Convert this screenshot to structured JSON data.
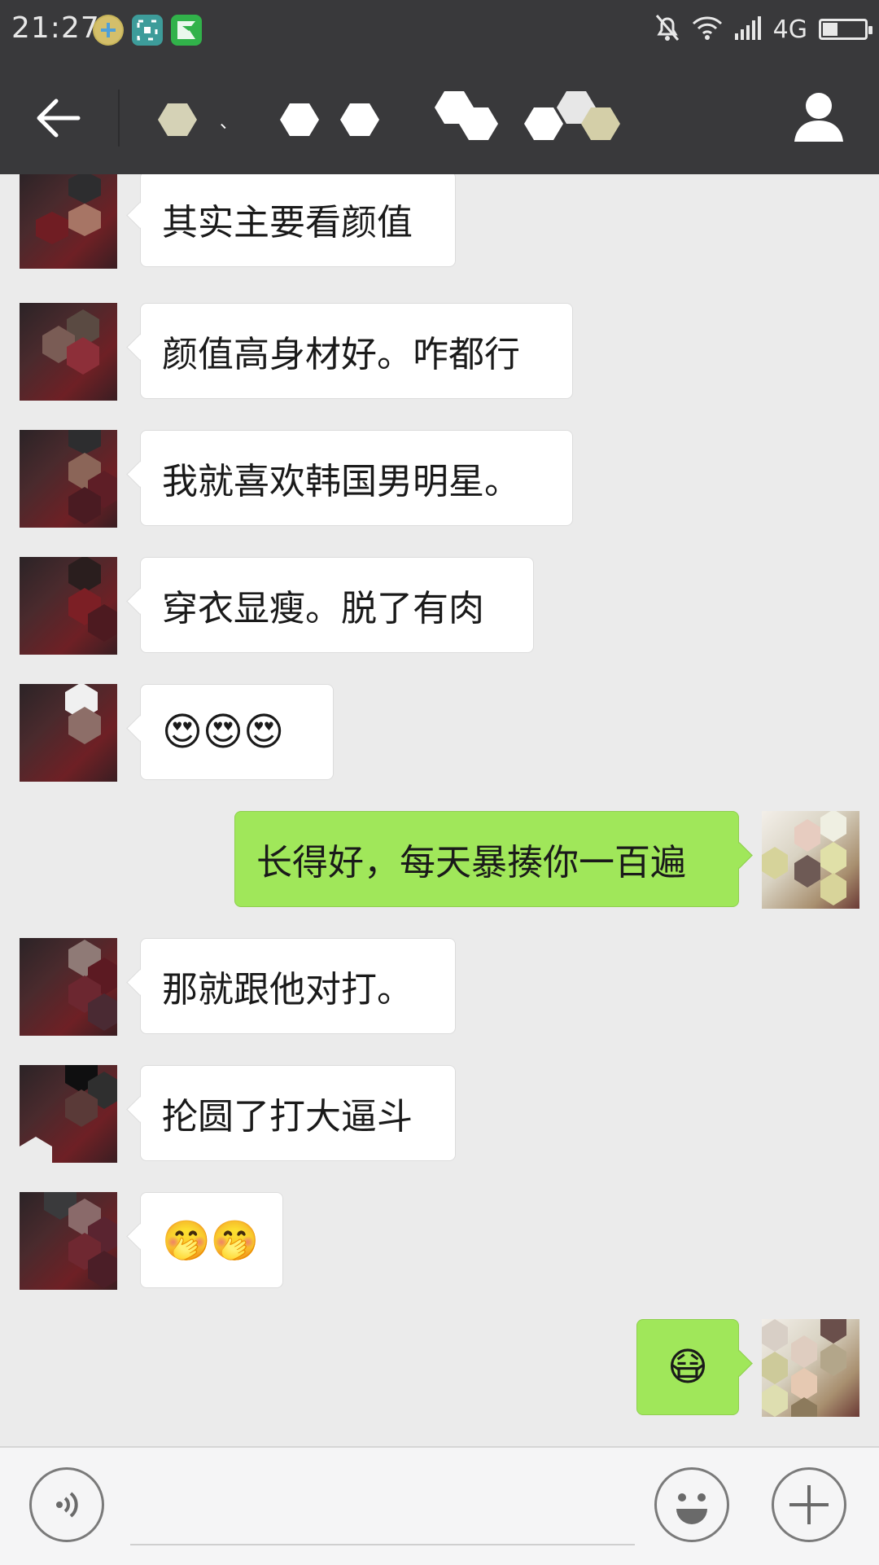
{
  "status_bar": {
    "time": "21:27",
    "network": "4G",
    "battery_level": 0.35,
    "icons": [
      "app-green-plus-icon",
      "app-scan-icon",
      "app-green-flag-icon",
      "mute-bell-icon",
      "wifi-icon",
      "signal-icon",
      "battery-icon"
    ]
  },
  "header": {
    "title_visible": "、",
    "back_icon": "arrow-left-icon",
    "profile_icon": "person-icon"
  },
  "messages": [
    {
      "side": "left",
      "type": "text",
      "text": "其实主要看颜值"
    },
    {
      "side": "left",
      "type": "text",
      "text": "颜值高身材好。咋都行"
    },
    {
      "side": "left",
      "type": "text",
      "text": "我就喜欢韩国男明星。"
    },
    {
      "side": "left",
      "type": "text",
      "text": "穿衣显瘦。脱了有肉"
    },
    {
      "side": "left",
      "type": "emoji",
      "text": "😍😍😍"
    },
    {
      "side": "right",
      "type": "text",
      "text": "长得好，每天暴揍你一百遍"
    },
    {
      "side": "left",
      "type": "text",
      "text": "那就跟他对打。"
    },
    {
      "side": "left",
      "type": "text",
      "text": "抡圆了打大逼斗"
    },
    {
      "side": "left",
      "type": "emoji",
      "text": "🤭🤭"
    },
    {
      "side": "right",
      "type": "emoji",
      "text": "😷"
    }
  ],
  "input_bar": {
    "voice_icon": "voice-icon",
    "emoji_icon": "smiley-icon",
    "plus_icon": "plus-icon"
  },
  "colors": {
    "header_bg": "#39393b",
    "chat_bg": "#ebebeb",
    "bubble_left": "#ffffff",
    "bubble_right": "#a0e75a"
  }
}
